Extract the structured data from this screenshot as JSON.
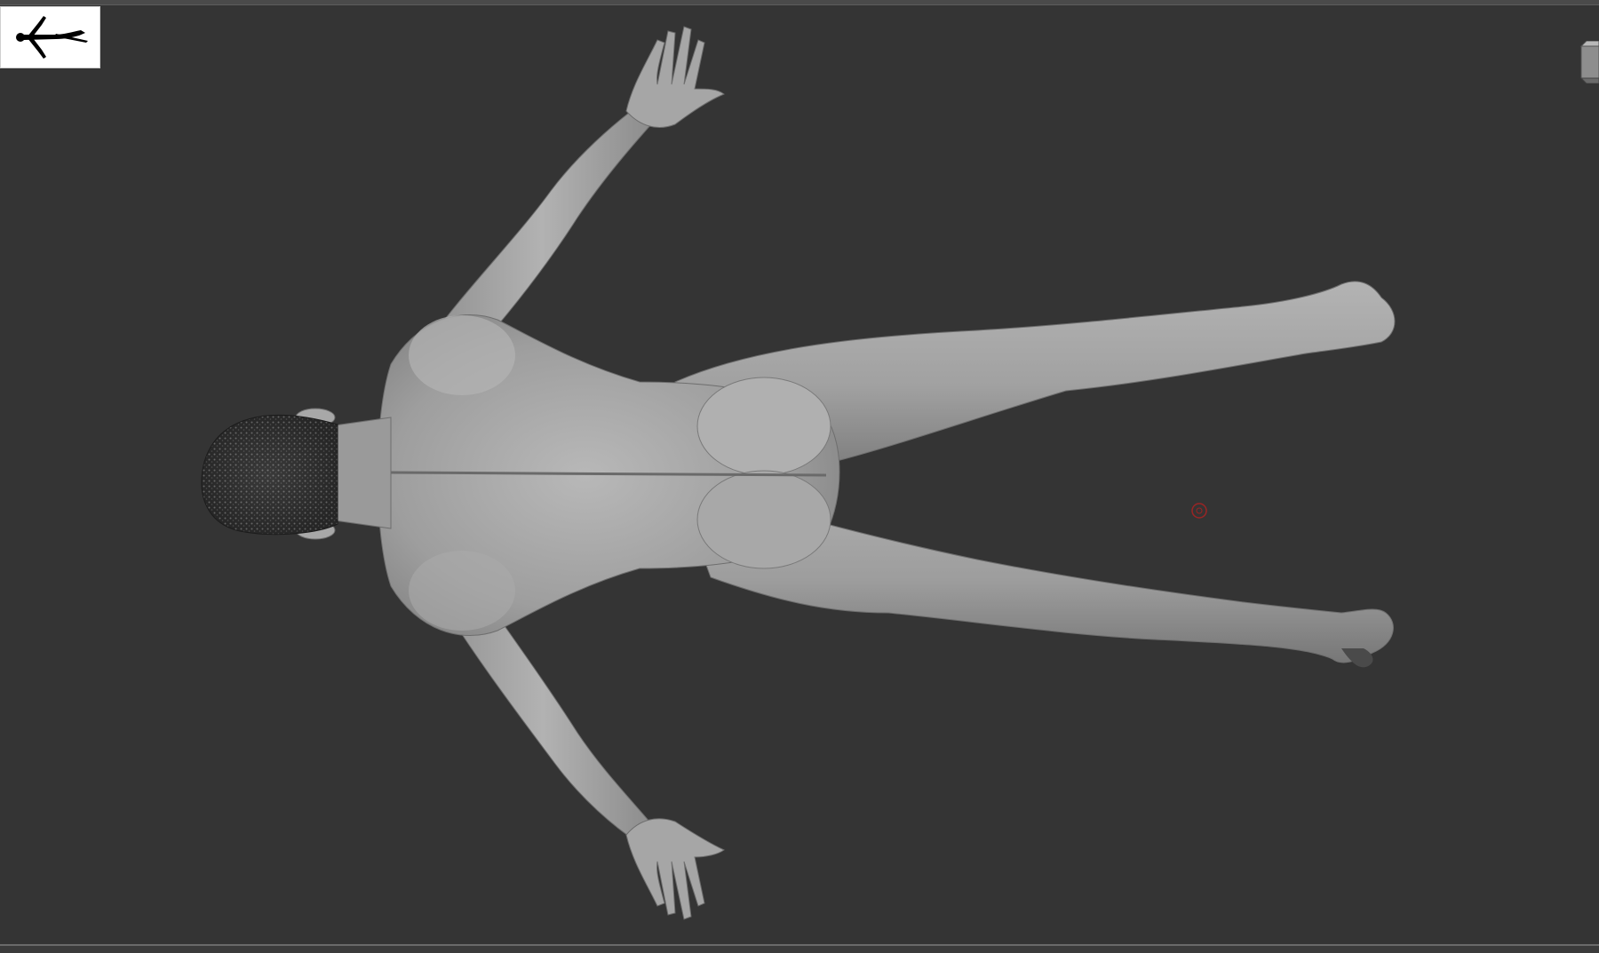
{
  "app": {
    "viewport_background": "#343434",
    "model_color": "#9c9c9c"
  },
  "icons": {
    "pose_thumbnail": "human-figure-icon",
    "navigation_cube": "nav-cube-icon",
    "brush_cursor": "brush-cursor-icon"
  },
  "colors": {
    "skin_light": "#b4b4b4",
    "skin_mid": "#9a9a9a",
    "skin_shadow": "#6e6e6e",
    "hair": "#2a2a2a",
    "cursor": "#9b2424"
  }
}
